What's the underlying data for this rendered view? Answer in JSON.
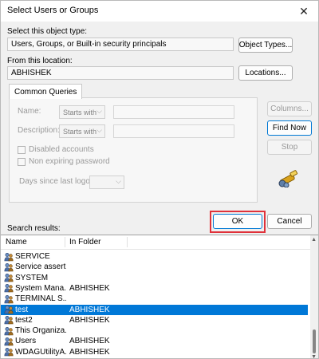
{
  "window": {
    "title": "Select Users or Groups",
    "close_glyph": "✕"
  },
  "object_type": {
    "label": "Select this object type:",
    "value": "Users, Groups, or Built-in security principals",
    "button": "Object Types..."
  },
  "location": {
    "label": "From this location:",
    "value": "ABHISHEK",
    "button": "Locations..."
  },
  "queries": {
    "tab_label": "Common Queries",
    "name_label": "Name:",
    "name_mode": "Starts with",
    "description_label": "Description:",
    "description_mode": "Starts with",
    "disabled_accounts": "Disabled accounts",
    "non_expiring_password": "Non expiring password",
    "days_since_logon": "Days since last logon:",
    "columns_button": "Columns...",
    "find_now_button": "Find Now",
    "stop_button": "Stop"
  },
  "actions": {
    "ok": "OK",
    "cancel": "Cancel"
  },
  "results": {
    "label": "Search results:",
    "columns": [
      "Name",
      "In Folder"
    ],
    "rows": [
      {
        "name": "SERVICE",
        "folder": "",
        "selected": false
      },
      {
        "name": "Service assert...",
        "folder": "",
        "selected": false
      },
      {
        "name": "SYSTEM",
        "folder": "",
        "selected": false
      },
      {
        "name": "System Mana...",
        "folder": "ABHISHEK",
        "selected": false
      },
      {
        "name": "TERMINAL S...",
        "folder": "",
        "selected": false
      },
      {
        "name": "test",
        "folder": "ABHISHEK",
        "selected": true
      },
      {
        "name": "test2",
        "folder": "ABHISHEK",
        "selected": false
      },
      {
        "name": "This Organiza...",
        "folder": "",
        "selected": false
      },
      {
        "name": "Users",
        "folder": "ABHISHEK",
        "selected": false
      },
      {
        "name": "WDAGUtilityA...",
        "folder": "ABHISHEK",
        "selected": false
      }
    ]
  },
  "colors": {
    "selection": "#0078d7",
    "highlight_border": "#e0313a",
    "default_button_border": "#0078d4"
  },
  "icons": {
    "row_icon": "user-group-icon",
    "search_icon": "search-binoculars-icon"
  }
}
